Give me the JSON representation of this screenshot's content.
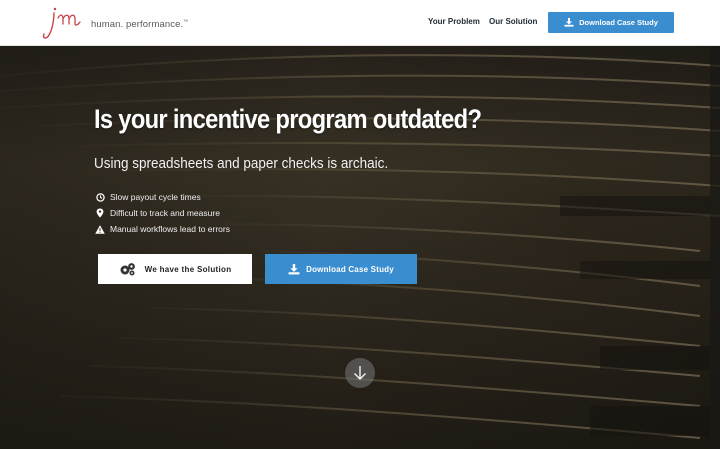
{
  "header": {
    "logo_alt": "jm",
    "tagline": "human. performance.",
    "tagline_mark": "™",
    "nav": [
      {
        "label": "Your Problem"
      },
      {
        "label": "Our Solution"
      }
    ],
    "cta_label": "Download Case Study"
  },
  "hero": {
    "title": "Is your incentive program outdated?",
    "subtitle": "Using spreadsheets and paper checks is archaic.",
    "bullets": [
      {
        "icon": "clock-icon",
        "text": "Slow payout cycle times"
      },
      {
        "icon": "map-pin-icon",
        "text": "Difficult to track and measure"
      },
      {
        "icon": "warning-icon",
        "text": "Manual workflows lead to errors"
      }
    ],
    "primary_button": "We have the Solution",
    "secondary_button": "Download Case Study"
  },
  "colors": {
    "accent_blue": "#3a8ed0",
    "logo_red": "#c9434b"
  }
}
